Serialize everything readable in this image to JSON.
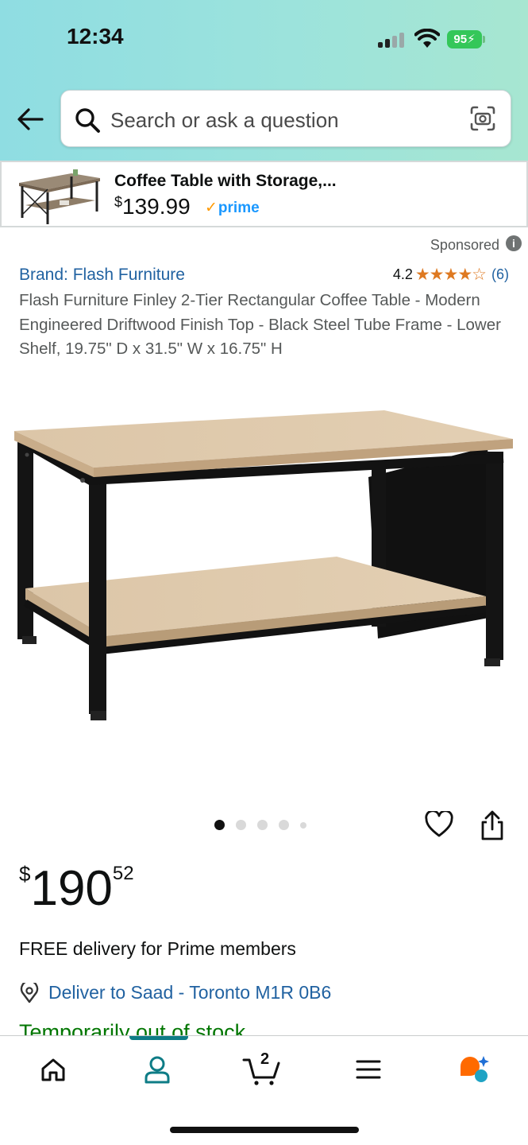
{
  "status_bar": {
    "time": "12:34",
    "battery": "95"
  },
  "search": {
    "placeholder": "Search or ask a question"
  },
  "sponsored_banner": {
    "title": "Coffee Table with Storage,...",
    "price_symbol": "$",
    "price": "139.99",
    "prime_check": "✓",
    "prime_label": "prime"
  },
  "product": {
    "sponsored_label": "Sponsored",
    "info_icon_glyph": "i",
    "brand": "Brand: Flash Furniture",
    "rating": "4.2",
    "stars": "★★★★☆",
    "rating_count": "(6)",
    "title": "Flash Furniture Finley 2-Tier Rectangular Coffee Table - Modern Engineered Driftwood Finish Top - Black Steel Tube Frame - Lower Shelf, 19.75\" D x 31.5\" W x 16.75\" H",
    "image_count": 5,
    "active_image": 1,
    "price": {
      "currency": "$",
      "whole": "190",
      "fraction": "52"
    },
    "delivery": "FREE delivery for Prime members",
    "deliver_to": "Deliver to Saad - Toronto M1R 0B6",
    "stock": "Temporarily out of stock"
  },
  "bottom_nav": {
    "cart_count": "2"
  },
  "colors": {
    "header_gradient_start": "#8fdde2",
    "header_gradient_end": "#a7e6d1",
    "link": "#2162a1",
    "stars": "#de7921",
    "prime": "#1a98ff",
    "in_stock_green": "#007600",
    "nav_active": "#0e7c86"
  },
  "icons": [
    "back-arrow-icon",
    "search-icon",
    "camera-icon",
    "info-icon",
    "heart-icon",
    "share-icon",
    "location-pin-icon",
    "home-icon",
    "account-icon",
    "cart-icon",
    "menu-icon",
    "rufus-icon"
  ]
}
